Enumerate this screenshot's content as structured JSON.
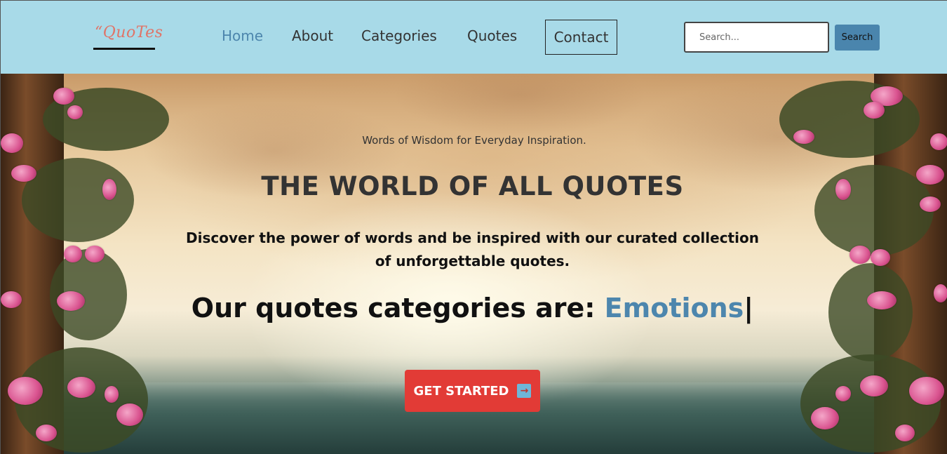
{
  "logo": {
    "text": "“QuoTes"
  },
  "nav": {
    "items": [
      {
        "label": "Home",
        "active": true
      },
      {
        "label": "About",
        "active": false
      },
      {
        "label": "Categories",
        "active": false
      },
      {
        "label": "Quotes",
        "active": false
      },
      {
        "label": "Contact",
        "active": false
      }
    ]
  },
  "search": {
    "placeholder": "Search...",
    "value": "",
    "button_label": "Search"
  },
  "hero": {
    "tagline": "Words of Wisdom for Everyday Inspiration.",
    "title": "THE WORLD OF ALL QUOTES",
    "description": "Discover the power of words and be inspired with our curated collection of unforgettable quotes.",
    "categories_prefix": "Our quotes categories are: ",
    "categories_current": "Emotions",
    "cursor": "|",
    "cta_label": "GET STARTED",
    "cta_icon": "arrow-right-icon"
  },
  "colors": {
    "navbar_bg": "#a8dae8",
    "accent_blue": "#4d86ad",
    "cta_red": "#e23b36",
    "logo_color": "#e07468"
  }
}
